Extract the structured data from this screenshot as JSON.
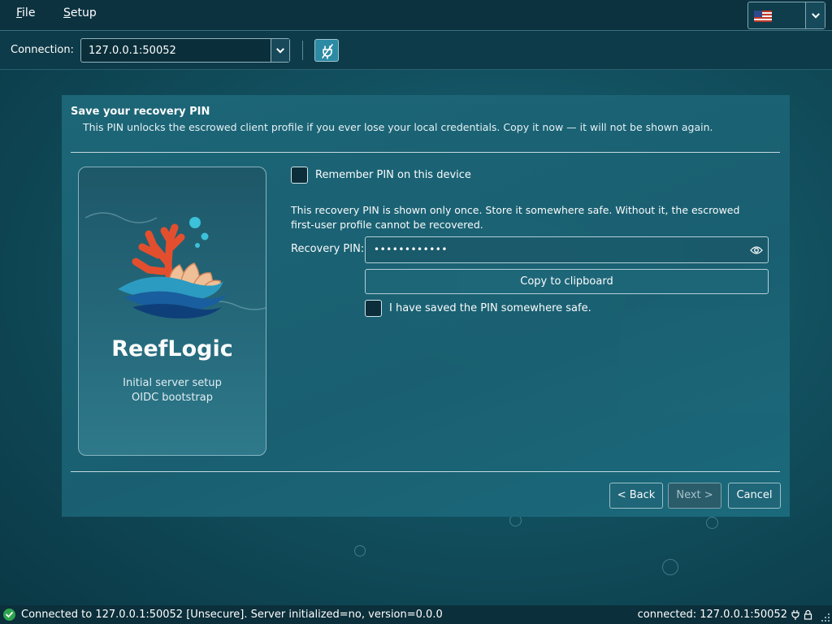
{
  "menu": {
    "file": "File",
    "file_mnemonic": "F",
    "file_rest": "ile",
    "setup": "Setup",
    "setup_mnemonic": "S",
    "setup_rest": "etup"
  },
  "language": {
    "selected_icon": "us-flag-icon"
  },
  "connection": {
    "label": "Connection:",
    "value": "127.0.0.1:50052",
    "disconnect_icon": "plug-disconnected-icon"
  },
  "wizard": {
    "title": "Save your recovery PIN",
    "subtitle": "This PIN unlocks the escrowed client profile if you ever lose your local credentials. Copy it now — it will not be shown again.",
    "brand": {
      "name": "ReefLogic",
      "line1": "Initial server setup",
      "line2": "OIDC bootstrap"
    },
    "remember_label": "Remember PIN on this device",
    "info": "This recovery PIN is shown only once. Store it somewhere safe. Without it, the escrowed first-user profile cannot be recovered.",
    "pin_label": "Recovery PIN:",
    "pin_masked": "••••••••••••",
    "copy_label": "Copy to clipboard",
    "saved_label": "I have saved the PIN somewhere safe.",
    "back_label": "< Back",
    "next_label": "Next >",
    "cancel_label": "Cancel"
  },
  "status": {
    "left": "Connected to 127.0.0.1:50052 [Unsecure]. Server initialized=no, version=0.0.0",
    "right": "connected: 127.0.0.1:50052",
    "ok_color": "#2ea44f"
  }
}
